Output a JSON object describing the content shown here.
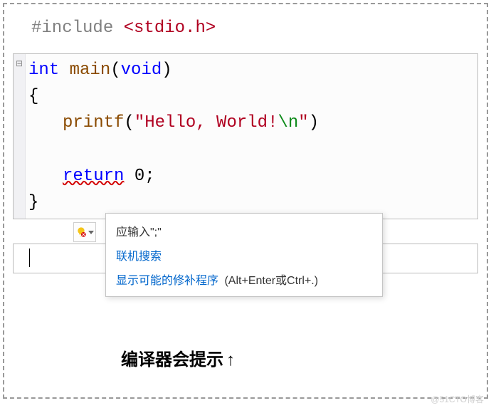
{
  "code": {
    "include_hash": "#include ",
    "include_open": "<",
    "include_name": "stdio.h",
    "include_close": ">",
    "main_int": "int",
    "main_name": " main",
    "main_paren_open": "(",
    "main_void": "void",
    "main_paren_close": ")",
    "brace_open": "{",
    "printf_name": "printf",
    "printf_open": "(",
    "str_open": "\"",
    "str_body": "Hello, World!",
    "str_esc": "\\n",
    "str_close": "\"",
    "printf_close": ")",
    "return_kw": "return",
    "return_sp": " ",
    "return_val": "0",
    "return_semi": ";",
    "brace_close": "}"
  },
  "tooltip": {
    "message": "应输入\";\"",
    "search": "联机搜索",
    "fix": "显示可能的修补程序",
    "shortcut": "(Alt+Enter或Ctrl+.)"
  },
  "caption": {
    "text": "编译器会提示",
    "arrow": "↑"
  },
  "gutter": {
    "fold": "⊟"
  },
  "watermark": "@51CTO博客"
}
